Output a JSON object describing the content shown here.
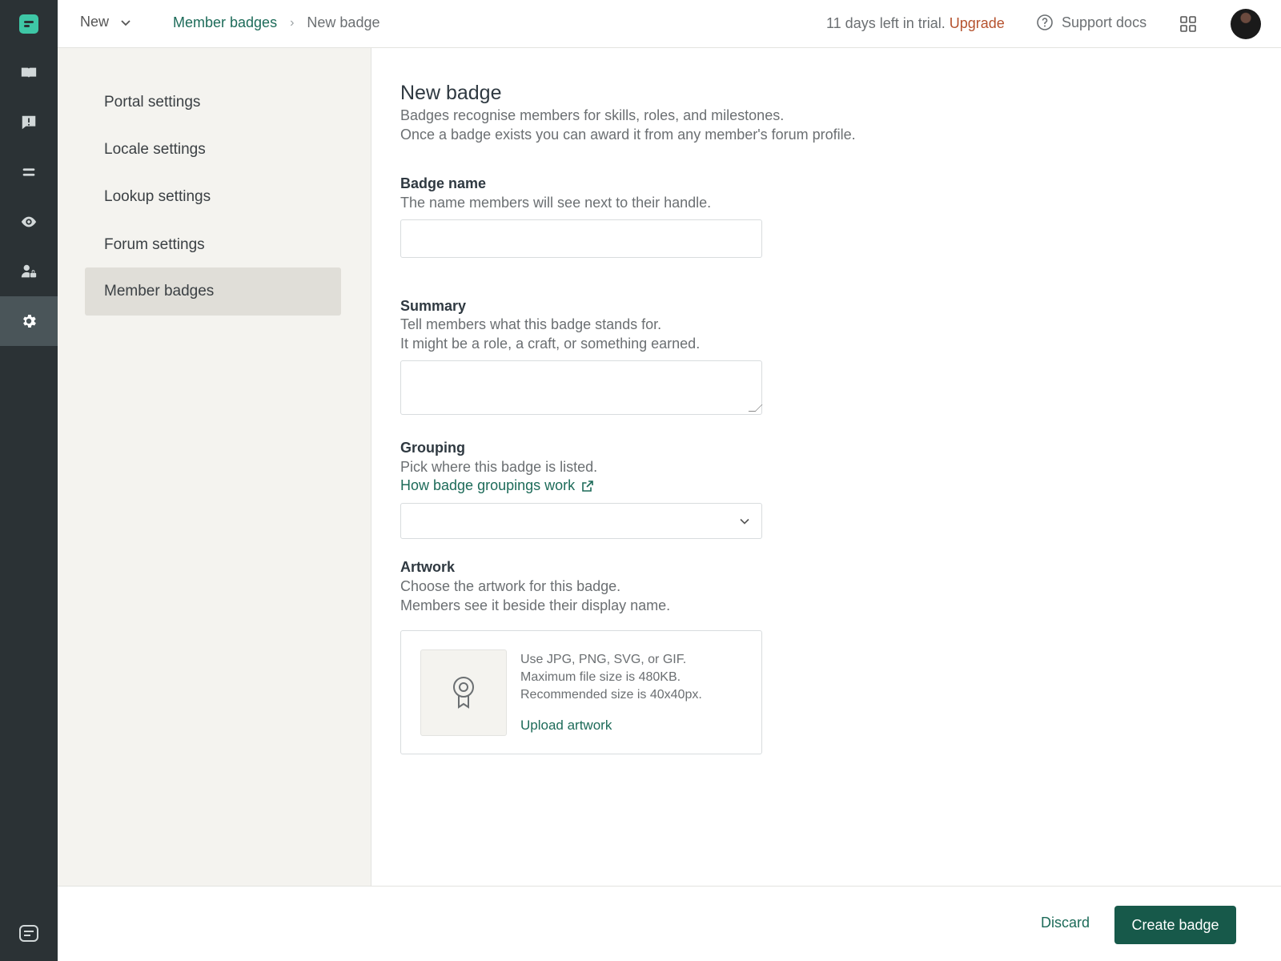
{
  "topbar": {
    "new_label": "New",
    "breadcrumb_parent": "Member badges",
    "breadcrumb_current": "New badge",
    "trial_text": "11 days left in trial.",
    "upgrade_label": "Upgrade",
    "support_label": "Support docs"
  },
  "sidebar": {
    "items": [
      {
        "label": "Portal settings"
      },
      {
        "label": "Locale settings"
      },
      {
        "label": "Lookup settings"
      },
      {
        "label": "Forum settings"
      },
      {
        "label": "Member badges",
        "active": true
      }
    ]
  },
  "page": {
    "title": "New badge",
    "description_1": "Badges recognise members for skills, roles, and milestones.",
    "description_2": "Once a badge exists you can award it from any member's forum profile."
  },
  "form": {
    "badge_name": {
      "label": "Badge name",
      "hint": "The name members will see next to their handle.",
      "value": ""
    },
    "summary": {
      "label": "Summary",
      "hint_1": "Tell members what this badge stands for.",
      "hint_2": "It might be a role, a craft, or something earned.",
      "value": ""
    },
    "grouping": {
      "label": "Grouping",
      "hint": "Pick where this badge is listed.",
      "help_link": "How badge groupings work",
      "selected": ""
    },
    "artwork": {
      "label": "Artwork",
      "hint_1": "Choose the artwork for this badge.",
      "hint_2": "Members see it beside their display name.",
      "info_1": "Use JPG, PNG, SVG, or GIF.",
      "info_2": "Maximum file size is 480KB.",
      "info_3": "Recommended size is 40x40px.",
      "upload_label": "Upload artwork"
    }
  },
  "footer": {
    "discard_label": "Discard",
    "create_label": "Create badge"
  },
  "colors": {
    "rail_bg": "#2b3235",
    "brand_accent": "#3ec7a6",
    "link": "#1d6b59",
    "primary_button": "#17594a",
    "upgrade": "#b5522e",
    "sidebar_bg": "#f4f3ef"
  },
  "icons": {
    "rail": [
      "brand-logo-icon",
      "book-icon",
      "alert-chat-icon",
      "menu-lines-icon",
      "eye-icon",
      "user-lock-icon",
      "gear-icon"
    ],
    "rail_bottom": "chat-card-icon",
    "topbar": [
      "chevron-down-icon",
      "chevron-right-icon",
      "help-circle-icon",
      "apps-grid-icon"
    ],
    "form": [
      "external-link-icon",
      "chevron-down-icon",
      "badge-ribbon-icon"
    ]
  }
}
